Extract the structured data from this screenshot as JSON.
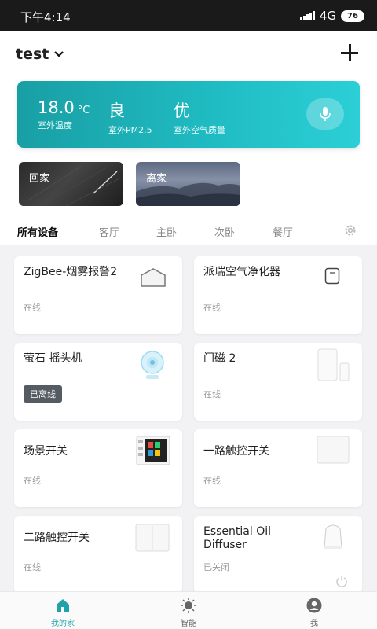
{
  "status_bar": {
    "time": "下午4:14",
    "network": "4G",
    "battery": "76"
  },
  "header": {
    "home_name": "test"
  },
  "weather": {
    "temperature": "18.0",
    "temperature_unit": "°C",
    "temperature_label": "室外温度",
    "pm25": "良",
    "pm25_label": "室外PM2.5",
    "air_quality": "优",
    "air_quality_label": "室外空气质量"
  },
  "scenes": [
    {
      "label": "回家"
    },
    {
      "label": "离家"
    }
  ],
  "tabs": [
    {
      "label": "所有设备",
      "active": true
    },
    {
      "label": "客厅"
    },
    {
      "label": "主卧"
    },
    {
      "label": "次卧"
    },
    {
      "label": "餐厅"
    }
  ],
  "devices": [
    {
      "name": "ZigBee-烟雾报警2",
      "status": "在线"
    },
    {
      "name": "派瑞空气净化器",
      "status": "在线"
    },
    {
      "name": "萤石 摇头机",
      "status": "已离线"
    },
    {
      "name": "门磁 2",
      "status": "在线"
    },
    {
      "name": "场景开关",
      "status": "在线"
    },
    {
      "name": "一路触控开关",
      "status": "在线"
    },
    {
      "name": "二路触控开关",
      "status": "在线"
    },
    {
      "name": "Essential Oil Diffuser",
      "status": "已关闭"
    }
  ],
  "bottom_nav": [
    {
      "label": "我的家",
      "active": true
    },
    {
      "label": "智能"
    },
    {
      "label": "我"
    }
  ],
  "colors": {
    "accent": "#1fa3a8",
    "weather_card": "#1db3ba",
    "offline_badge": "#555b63"
  }
}
